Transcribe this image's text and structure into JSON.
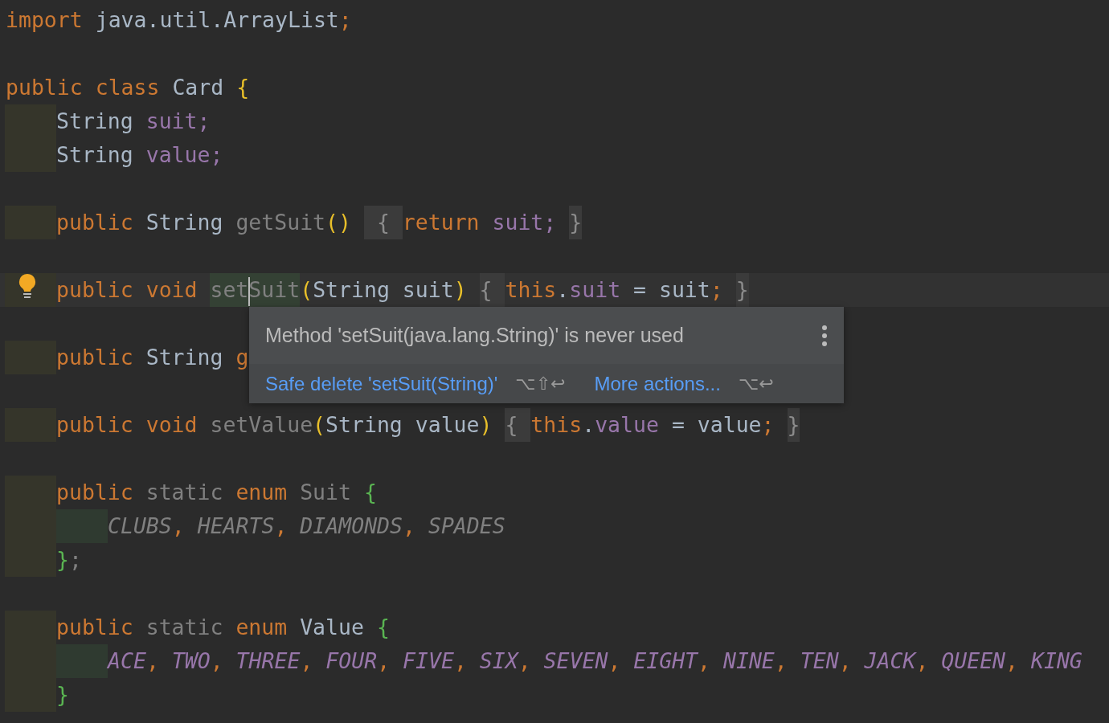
{
  "editor": {
    "lines": [
      {
        "kind": "code",
        "tokens": [
          {
            "kind": "keyword",
            "text": "import"
          },
          {
            "kind": "type",
            "text": " java.util.ArrayList"
          },
          {
            "kind": "keyword",
            "text": ";"
          }
        ]
      },
      {
        "kind": "blank"
      },
      {
        "kind": "code",
        "tokens": [
          {
            "kind": "keyword",
            "text": "public class"
          },
          {
            "kind": "type",
            "text": " Card "
          },
          {
            "kind": "paren",
            "text": "{"
          }
        ],
        "children": [
          {
            "kind": "code",
            "tokens": [
              {
                "kind": "type",
                "text": "String "
              },
              {
                "kind": "field",
                "text": "suit;"
              }
            ]
          },
          {
            "kind": "code",
            "tokens": [
              {
                "kind": "type",
                "text": "String "
              },
              {
                "kind": "field",
                "text": "value;"
              }
            ]
          },
          {
            "kind": "blank"
          },
          {
            "kind": "code",
            "tokens": [
              {
                "kind": "keyword",
                "text": "public "
              },
              {
                "kind": "type",
                "text": "String "
              },
              {
                "kind": "unused",
                "text": "getSuit"
              },
              {
                "kind": "paren",
                "text": "() "
              },
              {
                "kind": "folded",
                "text": " { "
              },
              {
                "kind": "keyword",
                "text": "return "
              },
              {
                "kind": "field",
                "text": "suit; "
              },
              {
                "kind": "folded",
                "text": "}"
              }
            ]
          },
          {
            "kind": "blank"
          },
          {
            "kind": "code",
            "current": true,
            "bulb": true,
            "tokens": [
              {
                "kind": "keyword",
                "text": "public void "
              },
              {
                "kind": "highlighted",
                "text": "set"
              },
              {
                "kind": "highlighted",
                "text": "Suit",
                "caret": true
              },
              {
                "kind": "paren",
                "text": "("
              },
              {
                "kind": "type",
                "text": "String suit"
              },
              {
                "kind": "paren",
                "text": ") "
              },
              {
                "kind": "folded",
                "text": "{ "
              },
              {
                "kind": "keyword",
                "text": "this"
              },
              {
                "kind": "type",
                "text": "."
              },
              {
                "kind": "field",
                "text": "suit"
              },
              {
                "kind": "type",
                "text": " = suit"
              },
              {
                "kind": "keyword",
                "text": "; "
              },
              {
                "kind": "folded",
                "text": "}"
              }
            ]
          },
          {
            "kind": "blank"
          },
          {
            "kind": "code",
            "tokens": [
              {
                "kind": "keyword",
                "text": "public "
              },
              {
                "kind": "type",
                "text": "String "
              },
              {
                "kind": "keyword",
                "text": "g"
              }
            ]
          },
          {
            "kind": "blank"
          },
          {
            "kind": "code",
            "tokens": [
              {
                "kind": "keyword",
                "text": "public void "
              },
              {
                "kind": "unused",
                "text": "setValue"
              },
              {
                "kind": "paren",
                "text": "("
              },
              {
                "kind": "type",
                "text": "String value"
              },
              {
                "kind": "paren",
                "text": ") "
              },
              {
                "kind": "folded",
                "text": "{ "
              },
              {
                "kind": "keyword",
                "text": "this"
              },
              {
                "kind": "type",
                "text": "."
              },
              {
                "kind": "field",
                "text": "value"
              },
              {
                "kind": "type",
                "text": " = value"
              },
              {
                "kind": "keyword",
                "text": "; "
              },
              {
                "kind": "folded",
                "text": "}"
              }
            ]
          },
          {
            "kind": "blank"
          },
          {
            "kind": "code",
            "tokens": [
              {
                "kind": "keyword",
                "text": "public "
              },
              {
                "kind": "unused",
                "text": "static "
              },
              {
                "kind": "keyword",
                "text": "enum "
              },
              {
                "kind": "unused",
                "text": "Suit "
              },
              {
                "kind": "brace",
                "text": "{"
              }
            ],
            "children": [
              {
                "kind": "code",
                "tokens": [
                  {
                    "kind": "unused-constant",
                    "text": "CLUBS"
                  },
                  {
                    "kind": "comma",
                    "text": ", "
                  },
                  {
                    "kind": "unused-constant",
                    "text": "HEARTS"
                  },
                  {
                    "kind": "comma",
                    "text": ", "
                  },
                  {
                    "kind": "unused-constant",
                    "text": "DIAMONDS"
                  },
                  {
                    "kind": "comma",
                    "text": ", "
                  },
                  {
                    "kind": "unused-constant",
                    "text": "SPADES"
                  }
                ]
              }
            ]
          },
          {
            "kind": "code",
            "tokens": [
              {
                "kind": "brace",
                "text": "}"
              },
              {
                "kind": "unused",
                "text": ";"
              }
            ]
          },
          {
            "kind": "blank"
          },
          {
            "kind": "code",
            "tokens": [
              {
                "kind": "keyword",
                "text": "public "
              },
              {
                "kind": "unused",
                "text": "static "
              },
              {
                "kind": "keyword",
                "text": "enum "
              },
              {
                "kind": "type",
                "text": "Value "
              },
              {
                "kind": "brace",
                "text": "{"
              }
            ],
            "children": [
              {
                "kind": "code",
                "tokens": [
                  {
                    "kind": "constant",
                    "text": "ACE"
                  },
                  {
                    "kind": "comma",
                    "text": ", "
                  },
                  {
                    "kind": "constant",
                    "text": "TWO"
                  },
                  {
                    "kind": "comma",
                    "text": ", "
                  },
                  {
                    "kind": "constant",
                    "text": "THREE"
                  },
                  {
                    "kind": "comma",
                    "text": ", "
                  },
                  {
                    "kind": "constant",
                    "text": "FOUR"
                  },
                  {
                    "kind": "comma",
                    "text": ", "
                  },
                  {
                    "kind": "constant",
                    "text": "FIVE"
                  },
                  {
                    "kind": "comma",
                    "text": ", "
                  },
                  {
                    "kind": "constant",
                    "text": "SIX"
                  },
                  {
                    "kind": "comma",
                    "text": ", "
                  },
                  {
                    "kind": "constant",
                    "text": "SEVEN"
                  },
                  {
                    "kind": "comma",
                    "text": ", "
                  },
                  {
                    "kind": "constant",
                    "text": "EIGHT"
                  },
                  {
                    "kind": "comma",
                    "text": ", "
                  },
                  {
                    "kind": "constant",
                    "text": "NINE"
                  },
                  {
                    "kind": "comma",
                    "text": ", "
                  },
                  {
                    "kind": "constant",
                    "text": "TEN"
                  },
                  {
                    "kind": "comma",
                    "text": ", "
                  },
                  {
                    "kind": "constant",
                    "text": "JACK"
                  },
                  {
                    "kind": "comma",
                    "text": ", "
                  },
                  {
                    "kind": "constant",
                    "text": "QUEEN"
                  },
                  {
                    "kind": "comma",
                    "text": ", "
                  },
                  {
                    "kind": "constant",
                    "text": "KING"
                  }
                ]
              }
            ]
          },
          {
            "kind": "code",
            "tokens": [
              {
                "kind": "brace",
                "text": "}"
              }
            ]
          }
        ]
      }
    ]
  },
  "popup": {
    "message": "Method 'setSuit(java.lang.String)' is never used",
    "actions": [
      {
        "label": "Safe delete 'setSuit(String)'",
        "shortcut": "⌥⇧↩"
      },
      {
        "label": "More actions...",
        "shortcut": "⌥↩"
      }
    ]
  }
}
